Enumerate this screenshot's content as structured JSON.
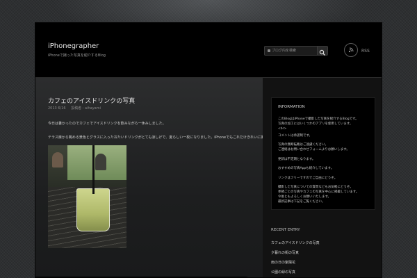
{
  "header": {
    "site_title": "iPhonegrapher",
    "site_description": "iPhoneで撮った写真を紹介するBlog",
    "search_placeholder": "ブログ内を検索",
    "search_button_icon": "magnifier-icon",
    "rss_icon": "rss-icon",
    "rss_label": "RSS"
  },
  "post": {
    "title": "カフェのアイスドリンクの写真",
    "date": "2013 6/16",
    "author": "投稿者 : aihayami",
    "line1": "今日は暑かったのでカフェでアイスドリンクを飲みながら一休みしました。",
    "line2": "テラス席から眺める景色とグラスに入った冷たいドリンクがとても涼しげで、夏らしい一枚になりました。iPhoneでもこれだけきれいに撮れるのは嬉しいですね。",
    "photo_alt": "テラス席のテーブルに置かれたアイスドリンク"
  },
  "sidebar": {
    "information": {
      "title": "INFORMATION",
      "lines": [
        "このBlogはiPhoneで撮影した写真を紹介するBlogです。",
        "写真の加工にはいくつかのアプリを使用しています。",
        "<br>",
        "コメントは承認制です。",
        "写真の無断転載はご遠慮ください。",
        "ご連絡はお問い合わせフォームよりお願いします。",
        "更新は不定期となります。",
        "おすすめの写真Appも紹介しています。",
        "リンクはフリーですのでご自由にどうぞ。",
        "撮影した写真についての質問などもお気軽にどうぞ。",
        "季節ごとの写真やカフェの写真を中心に掲載しています。",
        "今後ともよろしくお願いいたします。",
        "最新記事は下記をご覧ください。"
      ]
    },
    "recent": {
      "title": "RECENT ENTRY",
      "items": [
        "カフェのアイスドリンクの写真",
        "夕暮れの街の写真",
        "雨の日の紫陽花",
        "公園の緑の写真"
      ]
    }
  }
}
